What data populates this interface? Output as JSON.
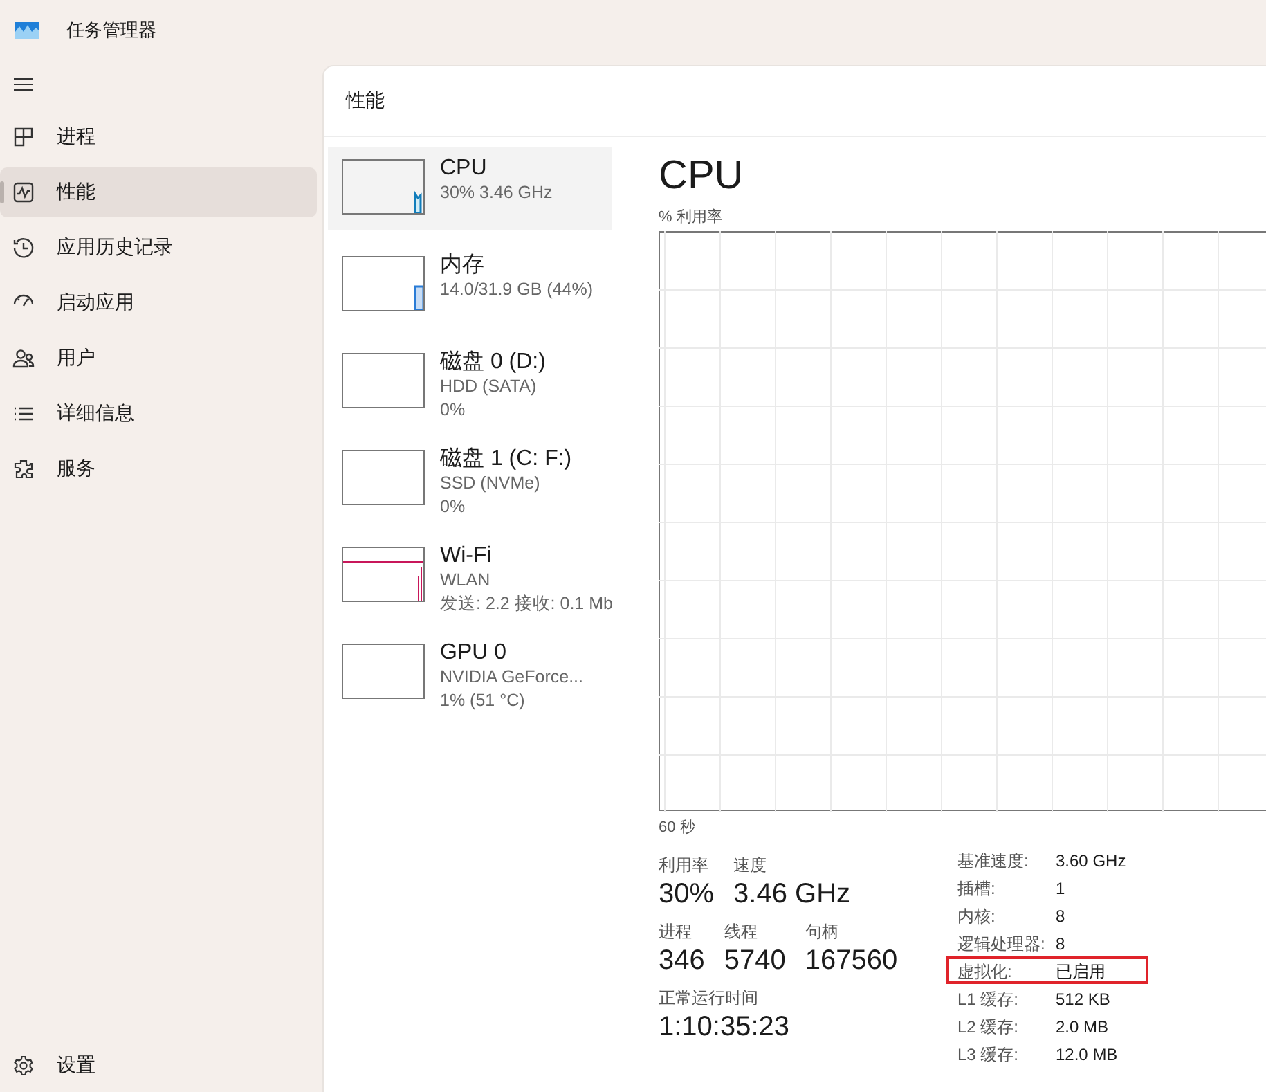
{
  "window": {
    "title": "任务管理器"
  },
  "sidebar": {
    "items": [
      {
        "label": "进程",
        "selected": false
      },
      {
        "label": "性能",
        "selected": true
      },
      {
        "label": "应用历史记录",
        "selected": false
      },
      {
        "label": "启动应用",
        "selected": false
      },
      {
        "label": "用户",
        "selected": false
      },
      {
        "label": "详细信息",
        "selected": false
      },
      {
        "label": "服务",
        "selected": false
      }
    ],
    "footer": {
      "label": "设置"
    }
  },
  "page": {
    "title": "性能"
  },
  "devices": [
    {
      "name": "CPU",
      "lines": [
        "30% 3.46 GHz"
      ],
      "selected": true,
      "kind": "cpu",
      "color": "#117dbb"
    },
    {
      "name": "内存",
      "lines": [
        "14.0/31.9 GB (44%)"
      ],
      "selected": false,
      "kind": "memory",
      "color": "#2a7cd6"
    },
    {
      "name": "磁盘 0 (D:)",
      "lines": [
        "HDD (SATA)",
        "0%"
      ],
      "selected": false,
      "kind": "disk"
    },
    {
      "name": "磁盘 1 (C: F:)",
      "lines": [
        "SSD (NVMe)",
        "0%"
      ],
      "selected": false,
      "kind": "disk"
    },
    {
      "name": "Wi-Fi",
      "lines": [
        "WLAN",
        "发送: 2.2 接收: 0.1 Mb"
      ],
      "selected": false,
      "kind": "network",
      "color": "#c8175a"
    },
    {
      "name": "GPU 0",
      "lines": [
        "NVIDIA GeForce...",
        "1% (51 °C)"
      ],
      "selected": false,
      "kind": "gpu"
    }
  ],
  "detail": {
    "title": "CPU",
    "graph_label": "% 利用率",
    "graph_time": "60 秒",
    "stats": [
      [
        {
          "label": "利用率",
          "value": "30%"
        },
        {
          "label": "速度",
          "value": "3.46 GHz"
        }
      ],
      [
        {
          "label": "进程",
          "value": "346"
        },
        {
          "label": "线程",
          "value": "5740"
        },
        {
          "label": "句柄",
          "value": "167560"
        }
      ],
      [
        {
          "label": "正常运行时间",
          "value": "1:10:35:23"
        }
      ]
    ],
    "specs": [
      {
        "label": "基准速度:",
        "value": "3.60 GHz",
        "highlighted": false
      },
      {
        "label": "插槽:",
        "value": "1",
        "highlighted": false
      },
      {
        "label": "内核:",
        "value": "8",
        "highlighted": false
      },
      {
        "label": "逻辑处理器:",
        "value": "8",
        "highlighted": false
      },
      {
        "label": "虚拟化:",
        "value": "已启用",
        "highlighted": true
      },
      {
        "label": "L1 缓存:",
        "value": "512 KB",
        "highlighted": false
      },
      {
        "label": "L2 缓存:",
        "value": "2.0 MB",
        "highlighted": false
      },
      {
        "label": "L3 缓存:",
        "value": "12.0 MB",
        "highlighted": false
      }
    ]
  }
}
